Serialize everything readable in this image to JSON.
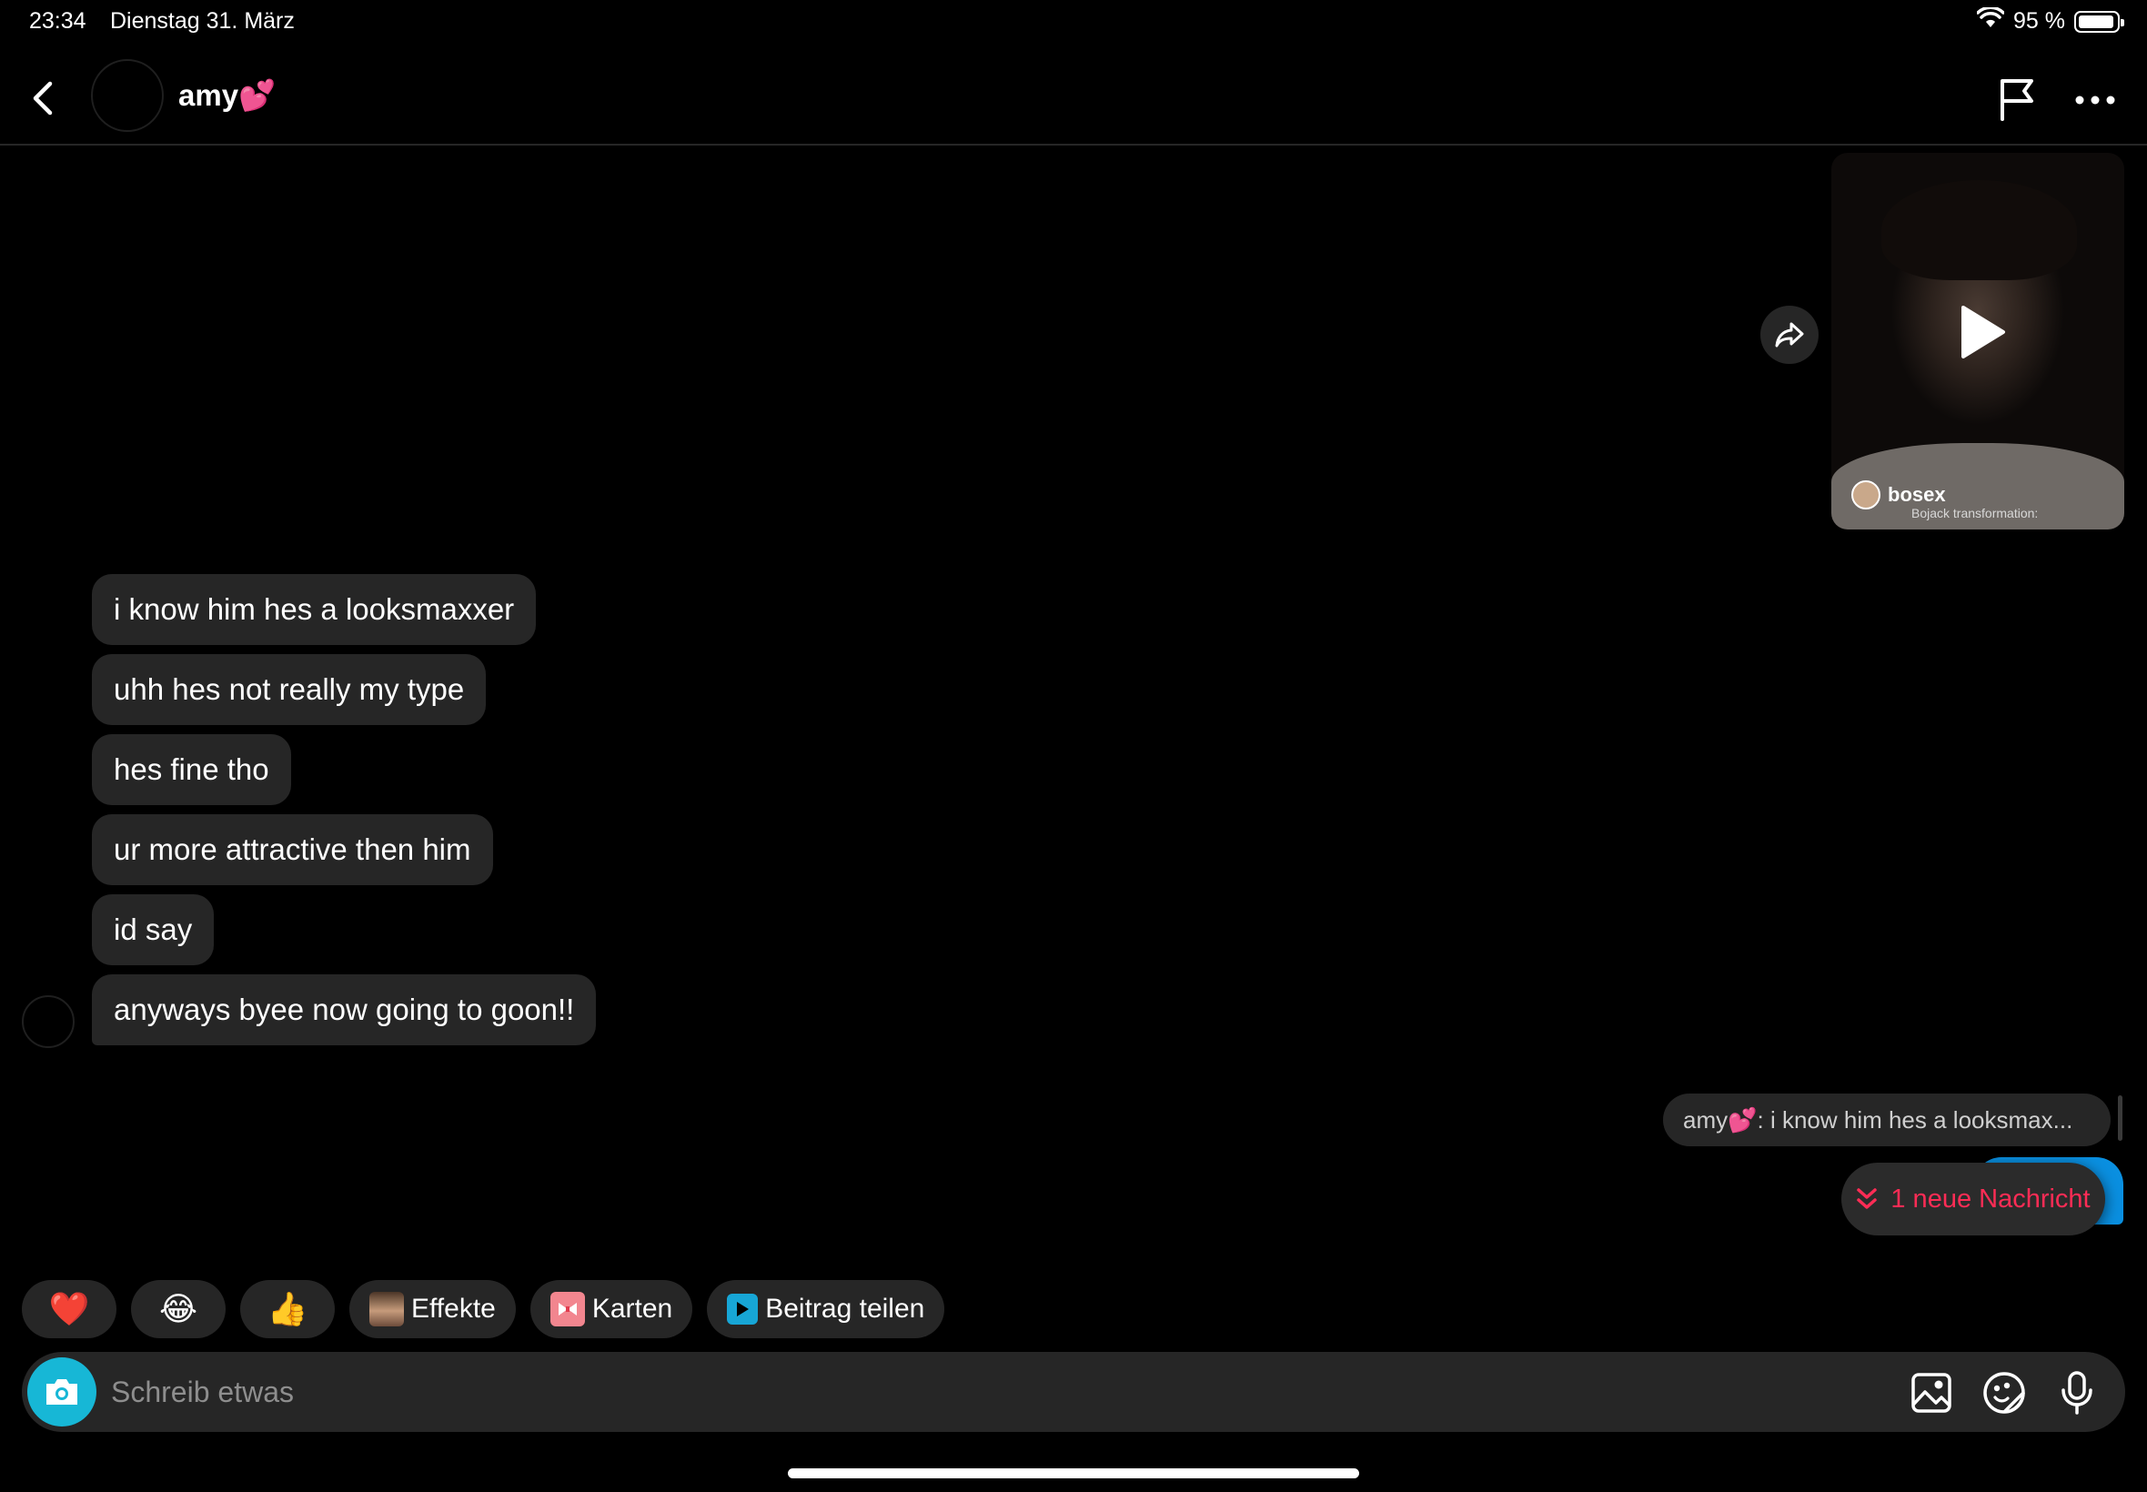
{
  "status_bar": {
    "time": "23:34",
    "date": "Dienstag 31. März",
    "battery": "95 %",
    "battery_level": 0.95
  },
  "header": {
    "contact_name": "amy💕"
  },
  "shared_video": {
    "username": "bosex",
    "caption": "Bojack transformation:"
  },
  "messages": [
    {
      "text": "i know him hes a looksmaxxer"
    },
    {
      "text": "uhh hes not really my type"
    },
    {
      "text": "hes fine tho"
    },
    {
      "text": "ur more attractive then him"
    },
    {
      "text": "id say"
    },
    {
      "text": "anyways byee now going to goon!!"
    }
  ],
  "reply_preview": {
    "text": "amy💕: i know him hes a looksmax..."
  },
  "new_message_pill": {
    "label": "1 neue Nachricht"
  },
  "quick_reactions": [
    {
      "label": "❤️"
    },
    {
      "label": "😂"
    },
    {
      "label": "👍"
    },
    {
      "label": "Effekte"
    },
    {
      "label": "Karten"
    },
    {
      "label": "Beitrag teilen"
    }
  ],
  "composer": {
    "placeholder": "Schreib etwas"
  },
  "colors": {
    "accent_red": "#fe2c55",
    "camera_cyan": "#17b7d6",
    "bubble_gray": "#262626",
    "sent_blue": "#0a8fe0"
  }
}
